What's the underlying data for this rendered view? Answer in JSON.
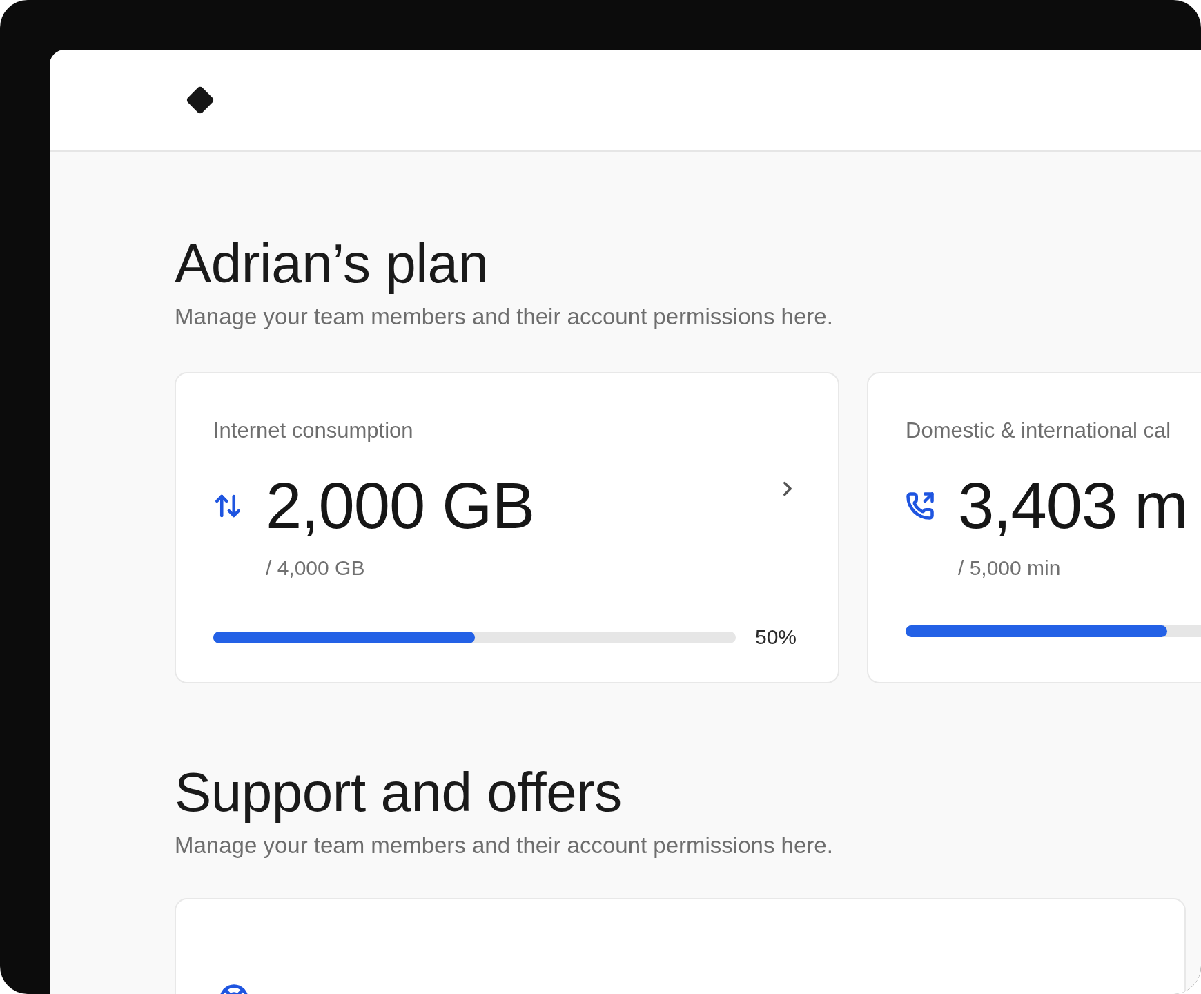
{
  "sections": [
    {
      "title": "Adrian’s plan",
      "subtitle": "Manage your team members and their account permissions here.",
      "cards": [
        {
          "kind": "data",
          "label": "Internet consumption",
          "value": "2,000 GB",
          "limit": "/ 4,000 GB",
          "level": 0.5,
          "percent": "50%",
          "chevron": true
        },
        {
          "kind": "calls",
          "label": "Domestic & international cal",
          "value": "3,403 m",
          "limit": "/ 5,000 min",
          "level": 0.5,
          "chevron": false
        }
      ]
    },
    {
      "title": "Support and offers",
      "subtitle": "Manage your team members and their account permissions here.",
      "cards": [
        {
          "kind": "support"
        }
      ]
    }
  ]
}
